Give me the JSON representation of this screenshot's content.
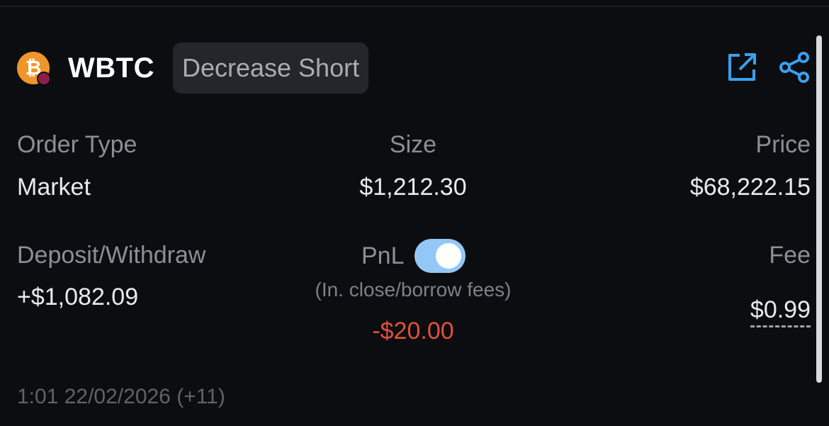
{
  "header": {
    "coin_glyph": "₿",
    "symbol": "WBTC",
    "action_tag": "Decrease Short",
    "icons": [
      "external-link-icon",
      "share-icon"
    ],
    "accent_color": "#3aa0f0"
  },
  "details": {
    "order_type": {
      "label": "Order Type",
      "value": "Market"
    },
    "size": {
      "label": "Size",
      "value": "$1,212.30"
    },
    "price": {
      "label": "Price",
      "value": "$68,222.15"
    },
    "deposit": {
      "label": "Deposit/Withdraw",
      "value": "+$1,082.09"
    },
    "pnl": {
      "label": "PnL",
      "toggle_on": true,
      "sub": "(In. close/borrow fees)",
      "value": "-$20.00",
      "color": "#e0513a"
    },
    "fee": {
      "label": "Fee",
      "value": "$0.99"
    }
  },
  "timestamp": "1:01 22/02/2026 (+11)"
}
